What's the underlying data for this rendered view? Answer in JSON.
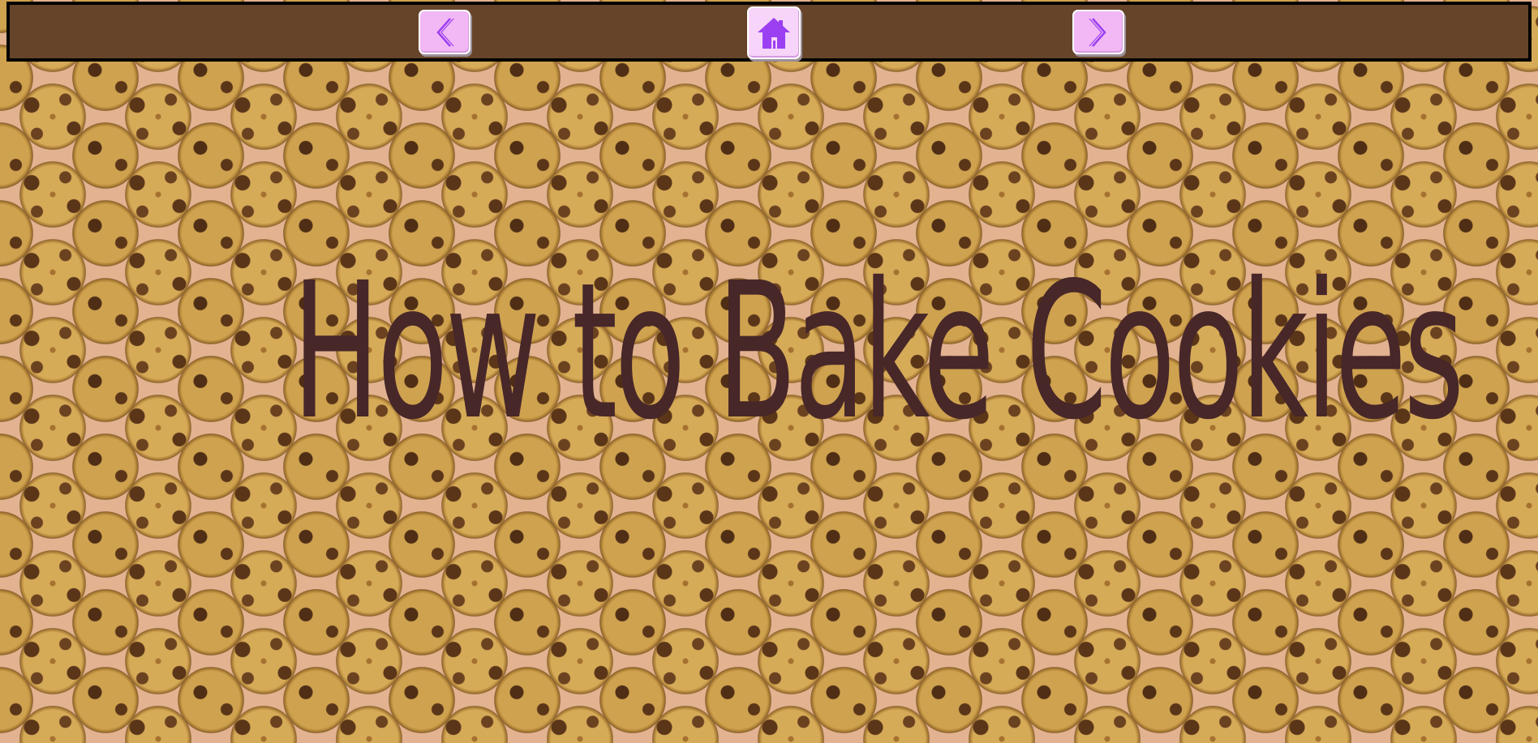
{
  "page": {
    "title": "How to Bake Cookies"
  },
  "nav": {
    "prev_icon": "chevron-left-icon",
    "home_icon": "home-icon",
    "next_icon": "chevron-right-icon"
  },
  "colors": {
    "navbar_bg": "#66442a",
    "navbar_border": "#000000",
    "button_bg": "#f2b8f5",
    "icon_accent": "#9b3ff2",
    "title_color": "#472728",
    "page_bg": "#e2b291"
  },
  "background": {
    "pattern": "chocolate-chip-cookie-tile"
  }
}
